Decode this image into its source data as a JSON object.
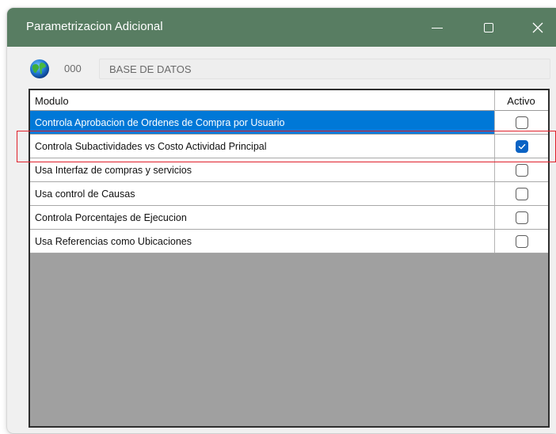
{
  "window": {
    "title": "Parametrizacion Adicional",
    "titlebar_color": "#587d62"
  },
  "database": {
    "icon": "globe-icon",
    "code": "000",
    "name": "BASE DE DATOS"
  },
  "grid": {
    "columns": [
      "Modulo",
      "Activo"
    ],
    "rows": [
      {
        "label": "Controla Aprobacion de Ordenes de Compra por Usuario",
        "active": false,
        "selected": true
      },
      {
        "label": "Controla Subactividades vs Costo Actividad Principal",
        "active": true,
        "selected": false
      },
      {
        "label": "Usa Interfaz de compras  y servicios",
        "active": false,
        "selected": false
      },
      {
        "label": "Usa control de Causas",
        "active": false,
        "selected": false
      },
      {
        "label": "Controla Porcentajes de Ejecucion",
        "active": false,
        "selected": false
      },
      {
        "label": "Usa Referencias como Ubicaciones",
        "active": false,
        "selected": false
      }
    ],
    "selection_color": "#0078d7",
    "check_color": "#0b63c4"
  },
  "annotation": {
    "highlight_color": "#e0202a"
  }
}
